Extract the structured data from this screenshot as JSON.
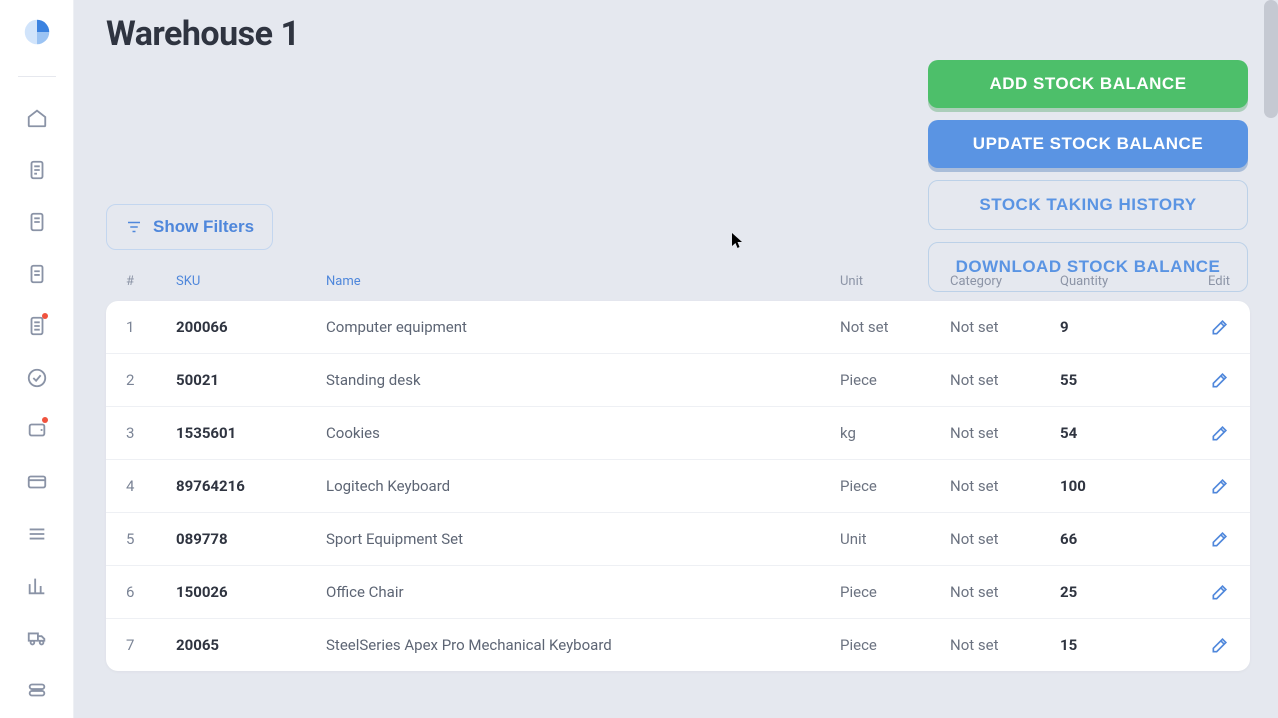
{
  "page_title": "Warehouse 1",
  "buttons": {
    "add_stock": "ADD STOCK BALANCE",
    "update_stock": "UPDATE STOCK BALANCE",
    "history": "STOCK TAKING HISTORY",
    "download": "DOWNLOAD STOCK BALANCE",
    "show_filters": "Show Filters"
  },
  "columns": {
    "idx": "#",
    "sku": "SKU",
    "name": "Name",
    "unit": "Unit",
    "category": "Category",
    "quantity": "Quantity",
    "edit": "Edit"
  },
  "rows": [
    {
      "idx": "1",
      "sku": "200066",
      "name": "Computer equipment",
      "unit": "Not set",
      "category": "Not set",
      "quantity": "9"
    },
    {
      "idx": "2",
      "sku": "50021",
      "name": "Standing desk",
      "unit": "Piece",
      "category": "Not set",
      "quantity": "55"
    },
    {
      "idx": "3",
      "sku": "1535601",
      "name": "Cookies",
      "unit": "kg",
      "category": "Not set",
      "quantity": "54"
    },
    {
      "idx": "4",
      "sku": "89764216",
      "name": "Logitech Keyboard",
      "unit": "Piece",
      "category": "Not set",
      "quantity": "100"
    },
    {
      "idx": "5",
      "sku": "089778",
      "name": "Sport Equipment Set",
      "unit": "Unit",
      "category": "Not set",
      "quantity": "66"
    },
    {
      "idx": "6",
      "sku": "150026",
      "name": "Office Chair",
      "unit": "Piece",
      "category": "Not set",
      "quantity": "25"
    },
    {
      "idx": "7",
      "sku": "20065",
      "name": "SteelSeries Apex Pro Mechanical Keyboard",
      "unit": "Piece",
      "category": "Not set",
      "quantity": "15"
    }
  ],
  "sidebar_items": [
    {
      "name": "home-icon"
    },
    {
      "name": "receipt-icon"
    },
    {
      "name": "document-icon"
    },
    {
      "name": "document2-icon"
    },
    {
      "name": "list-badge-icon",
      "dot": true
    },
    {
      "name": "check-circle-icon"
    },
    {
      "name": "wallet-icon",
      "dot": true
    },
    {
      "name": "card-icon"
    },
    {
      "name": "menu-icon"
    },
    {
      "name": "chart-icon"
    },
    {
      "name": "truck-icon"
    },
    {
      "name": "toggle-icon"
    }
  ]
}
